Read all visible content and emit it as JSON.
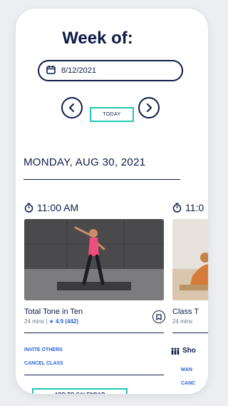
{
  "header": {
    "title": "Week of:"
  },
  "date_picker": {
    "value": "8/12/2021",
    "icon": "calendar-icon"
  },
  "nav": {
    "prev_icon": "chevron-left-icon",
    "next_icon": "chevron-right-icon",
    "today_label": "TODAY"
  },
  "day": {
    "title": "MONDAY, AUG 30, 2021"
  },
  "cards": [
    {
      "time": "11:00 AM",
      "title": "Total Tone in Ten",
      "duration": "24 mins",
      "separator": "|",
      "rating": "★ 4.9 (442)",
      "actions": {
        "invite": "INVITE OTHERS",
        "cancel": "CANCEL CLASS",
        "add": "ADD TO CALENDAR"
      }
    },
    {
      "time": "11:0",
      "title": "Class T",
      "duration": "24 mins",
      "show_label": "Sho",
      "link1": "MAN",
      "link2": "CANC"
    }
  ],
  "colors": {
    "navy": "#0f1b47",
    "teal": "#23c7b4",
    "blue": "#2962d9"
  }
}
